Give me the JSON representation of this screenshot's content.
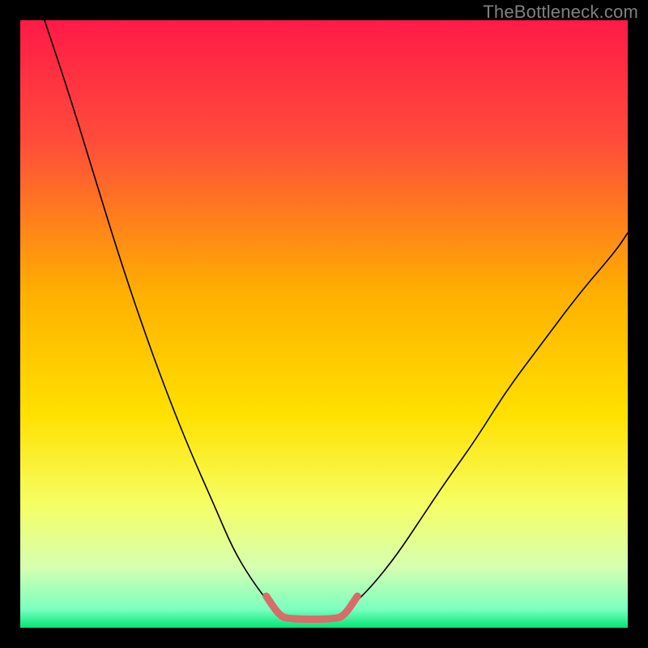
{
  "watermark": "TheBottleneck.com",
  "chart_data": {
    "type": "line",
    "title": "",
    "xlabel": "",
    "ylabel": "",
    "xlim": [
      0,
      100
    ],
    "ylim": [
      0,
      100
    ],
    "gradient_stops": [
      {
        "offset": 0,
        "color": "#ff1a47"
      },
      {
        "offset": 20,
        "color": "#ff4d3a"
      },
      {
        "offset": 45,
        "color": "#ffb000"
      },
      {
        "offset": 65,
        "color": "#ffe100"
      },
      {
        "offset": 80,
        "color": "#f5ff66"
      },
      {
        "offset": 90,
        "color": "#d6ffb0"
      },
      {
        "offset": 97,
        "color": "#7affc0"
      },
      {
        "offset": 100,
        "color": "#00e676"
      }
    ],
    "series": [
      {
        "name": "left-curve",
        "stroke": "#000000",
        "stroke_width": 1.6,
        "x": [
          4,
          8,
          12,
          16,
          20,
          24,
          28,
          32,
          35,
          38,
          41
        ],
        "y": [
          100,
          88,
          75,
          62,
          50,
          39,
          29,
          20,
          13,
          8,
          4
        ]
      },
      {
        "name": "right-curve",
        "stroke": "#000000",
        "stroke_width": 1.6,
        "x": [
          55,
          58,
          62,
          66,
          70,
          75,
          80,
          86,
          92,
          98,
          100
        ],
        "y": [
          4,
          7,
          12,
          18,
          24,
          31,
          39,
          47,
          55,
          62,
          65
        ]
      },
      {
        "name": "valley-highlight",
        "stroke": "#d96b6b",
        "stroke_width": 9,
        "x": [
          40.5,
          42.5,
          44,
          52,
          53.5,
          55.5
        ],
        "y": [
          5.2,
          2.2,
          1.4,
          1.4,
          2.2,
          5.2
        ]
      }
    ]
  }
}
